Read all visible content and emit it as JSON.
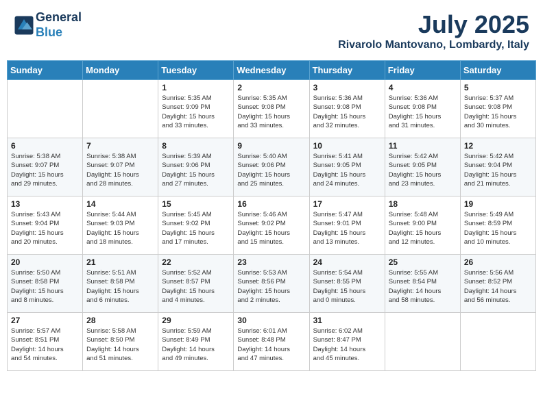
{
  "header": {
    "logo_line1": "General",
    "logo_line2": "Blue",
    "month_year": "July 2025",
    "location": "Rivarolo Mantovano, Lombardy, Italy"
  },
  "weekdays": [
    "Sunday",
    "Monday",
    "Tuesday",
    "Wednesday",
    "Thursday",
    "Friday",
    "Saturday"
  ],
  "weeks": [
    [
      {
        "day": "",
        "info": ""
      },
      {
        "day": "",
        "info": ""
      },
      {
        "day": "1",
        "info": "Sunrise: 5:35 AM\nSunset: 9:09 PM\nDaylight: 15 hours\nand 33 minutes."
      },
      {
        "day": "2",
        "info": "Sunrise: 5:35 AM\nSunset: 9:08 PM\nDaylight: 15 hours\nand 33 minutes."
      },
      {
        "day": "3",
        "info": "Sunrise: 5:36 AM\nSunset: 9:08 PM\nDaylight: 15 hours\nand 32 minutes."
      },
      {
        "day": "4",
        "info": "Sunrise: 5:36 AM\nSunset: 9:08 PM\nDaylight: 15 hours\nand 31 minutes."
      },
      {
        "day": "5",
        "info": "Sunrise: 5:37 AM\nSunset: 9:08 PM\nDaylight: 15 hours\nand 30 minutes."
      }
    ],
    [
      {
        "day": "6",
        "info": "Sunrise: 5:38 AM\nSunset: 9:07 PM\nDaylight: 15 hours\nand 29 minutes."
      },
      {
        "day": "7",
        "info": "Sunrise: 5:38 AM\nSunset: 9:07 PM\nDaylight: 15 hours\nand 28 minutes."
      },
      {
        "day": "8",
        "info": "Sunrise: 5:39 AM\nSunset: 9:06 PM\nDaylight: 15 hours\nand 27 minutes."
      },
      {
        "day": "9",
        "info": "Sunrise: 5:40 AM\nSunset: 9:06 PM\nDaylight: 15 hours\nand 25 minutes."
      },
      {
        "day": "10",
        "info": "Sunrise: 5:41 AM\nSunset: 9:05 PM\nDaylight: 15 hours\nand 24 minutes."
      },
      {
        "day": "11",
        "info": "Sunrise: 5:42 AM\nSunset: 9:05 PM\nDaylight: 15 hours\nand 23 minutes."
      },
      {
        "day": "12",
        "info": "Sunrise: 5:42 AM\nSunset: 9:04 PM\nDaylight: 15 hours\nand 21 minutes."
      }
    ],
    [
      {
        "day": "13",
        "info": "Sunrise: 5:43 AM\nSunset: 9:04 PM\nDaylight: 15 hours\nand 20 minutes."
      },
      {
        "day": "14",
        "info": "Sunrise: 5:44 AM\nSunset: 9:03 PM\nDaylight: 15 hours\nand 18 minutes."
      },
      {
        "day": "15",
        "info": "Sunrise: 5:45 AM\nSunset: 9:02 PM\nDaylight: 15 hours\nand 17 minutes."
      },
      {
        "day": "16",
        "info": "Sunrise: 5:46 AM\nSunset: 9:02 PM\nDaylight: 15 hours\nand 15 minutes."
      },
      {
        "day": "17",
        "info": "Sunrise: 5:47 AM\nSunset: 9:01 PM\nDaylight: 15 hours\nand 13 minutes."
      },
      {
        "day": "18",
        "info": "Sunrise: 5:48 AM\nSunset: 9:00 PM\nDaylight: 15 hours\nand 12 minutes."
      },
      {
        "day": "19",
        "info": "Sunrise: 5:49 AM\nSunset: 8:59 PM\nDaylight: 15 hours\nand 10 minutes."
      }
    ],
    [
      {
        "day": "20",
        "info": "Sunrise: 5:50 AM\nSunset: 8:58 PM\nDaylight: 15 hours\nand 8 minutes."
      },
      {
        "day": "21",
        "info": "Sunrise: 5:51 AM\nSunset: 8:58 PM\nDaylight: 15 hours\nand 6 minutes."
      },
      {
        "day": "22",
        "info": "Sunrise: 5:52 AM\nSunset: 8:57 PM\nDaylight: 15 hours\nand 4 minutes."
      },
      {
        "day": "23",
        "info": "Sunrise: 5:53 AM\nSunset: 8:56 PM\nDaylight: 15 hours\nand 2 minutes."
      },
      {
        "day": "24",
        "info": "Sunrise: 5:54 AM\nSunset: 8:55 PM\nDaylight: 15 hours\nand 0 minutes."
      },
      {
        "day": "25",
        "info": "Sunrise: 5:55 AM\nSunset: 8:54 PM\nDaylight: 14 hours\nand 58 minutes."
      },
      {
        "day": "26",
        "info": "Sunrise: 5:56 AM\nSunset: 8:52 PM\nDaylight: 14 hours\nand 56 minutes."
      }
    ],
    [
      {
        "day": "27",
        "info": "Sunrise: 5:57 AM\nSunset: 8:51 PM\nDaylight: 14 hours\nand 54 minutes."
      },
      {
        "day": "28",
        "info": "Sunrise: 5:58 AM\nSunset: 8:50 PM\nDaylight: 14 hours\nand 51 minutes."
      },
      {
        "day": "29",
        "info": "Sunrise: 5:59 AM\nSunset: 8:49 PM\nDaylight: 14 hours\nand 49 minutes."
      },
      {
        "day": "30",
        "info": "Sunrise: 6:01 AM\nSunset: 8:48 PM\nDaylight: 14 hours\nand 47 minutes."
      },
      {
        "day": "31",
        "info": "Sunrise: 6:02 AM\nSunset: 8:47 PM\nDaylight: 14 hours\nand 45 minutes."
      },
      {
        "day": "",
        "info": ""
      },
      {
        "day": "",
        "info": ""
      }
    ]
  ]
}
